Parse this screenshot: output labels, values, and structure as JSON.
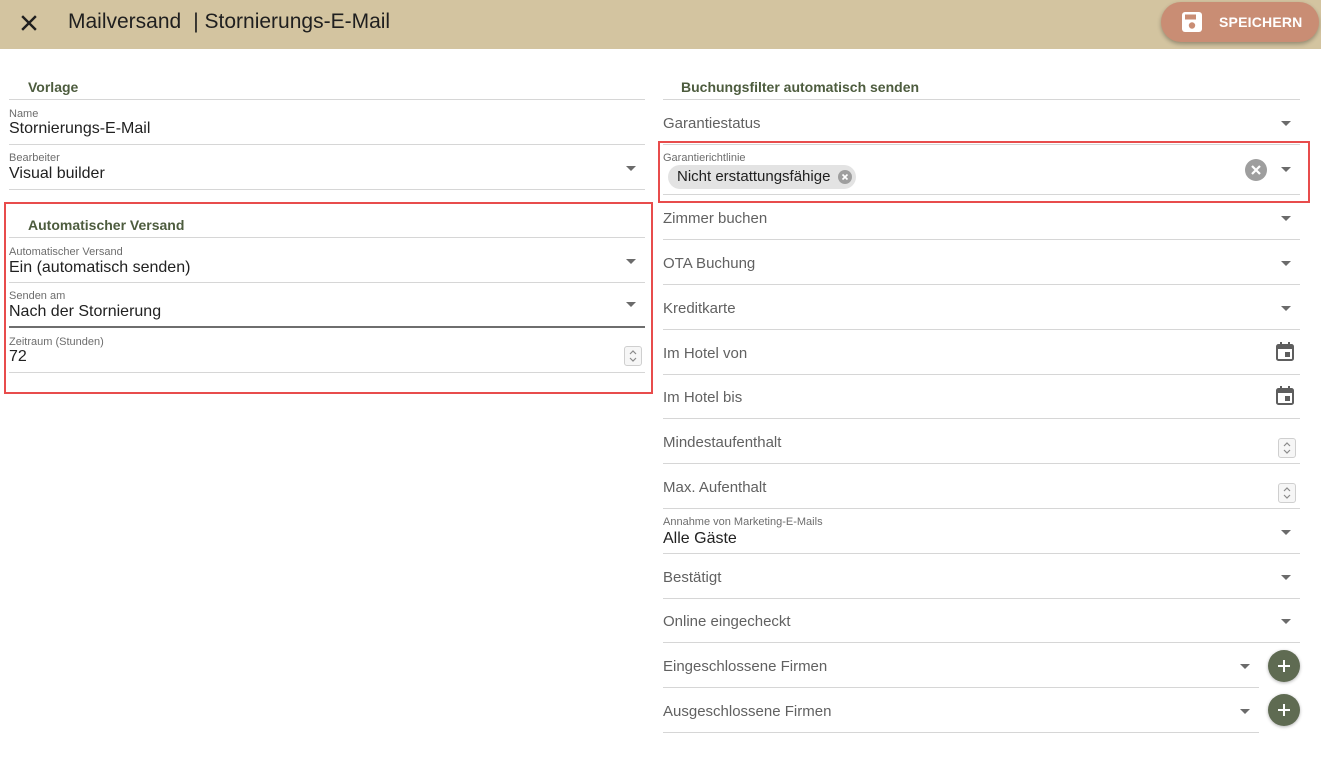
{
  "header": {
    "title": "Mailversand",
    "subtitle": "| Stornierungs-E-Mail",
    "save_label": "SPEICHERN",
    "bar_color": "#d3c4a0",
    "save_color": "#c98d74"
  },
  "vorlage": {
    "heading": "Vorlage",
    "name_label": "Name",
    "name_value": "Stornierungs-E-Mail",
    "editor_label": "Bearbeiter",
    "editor_value": "Visual builder"
  },
  "auto": {
    "heading": "Automatischer Versand",
    "mode_label": "Automatischer Versand",
    "mode_value": "Ein (automatisch senden)",
    "send_label": "Senden am",
    "send_value": "Nach der Stornierung",
    "period_label": "Zeitraum (Stunden)",
    "period_value": "72"
  },
  "filters": {
    "heading": "Buchungsfilter automatisch senden",
    "garantiestatus": "Garantiestatus",
    "garantierichtlinie_label": "Garantierichtlinie",
    "garantierichtlinie_chip": "Nicht erstattungsfähige",
    "zimmer": "Zimmer buchen",
    "ota": "OTA Buchung",
    "kreditkarte": "Kreditkarte",
    "hotel_von": "Im Hotel von",
    "hotel_bis": "Im Hotel bis",
    "mindest": "Mindestaufenthalt",
    "max": "Max. Aufenthalt",
    "marketing_label": "Annahme von Marketing-E-Mails",
    "marketing_value": "Alle Gäste",
    "bestaetigt": "Bestätigt",
    "online": "Online eingecheckt",
    "eingeschlossen": "Eingeschlossene Firmen",
    "ausgeschlossen": "Ausgeschlossene Firmen"
  },
  "icons": {
    "close": "close-icon",
    "save": "floppy-disk-icon",
    "dropdown": "caret-down-icon",
    "calendar": "calendar-icon",
    "stepper": "number-stepper-icon",
    "add": "plus-icon",
    "clear": "clear-x-icon"
  },
  "colors": {
    "highlight": "#e84c4c",
    "heading": "#4d5c3e",
    "add_button": "#5f6b52"
  }
}
